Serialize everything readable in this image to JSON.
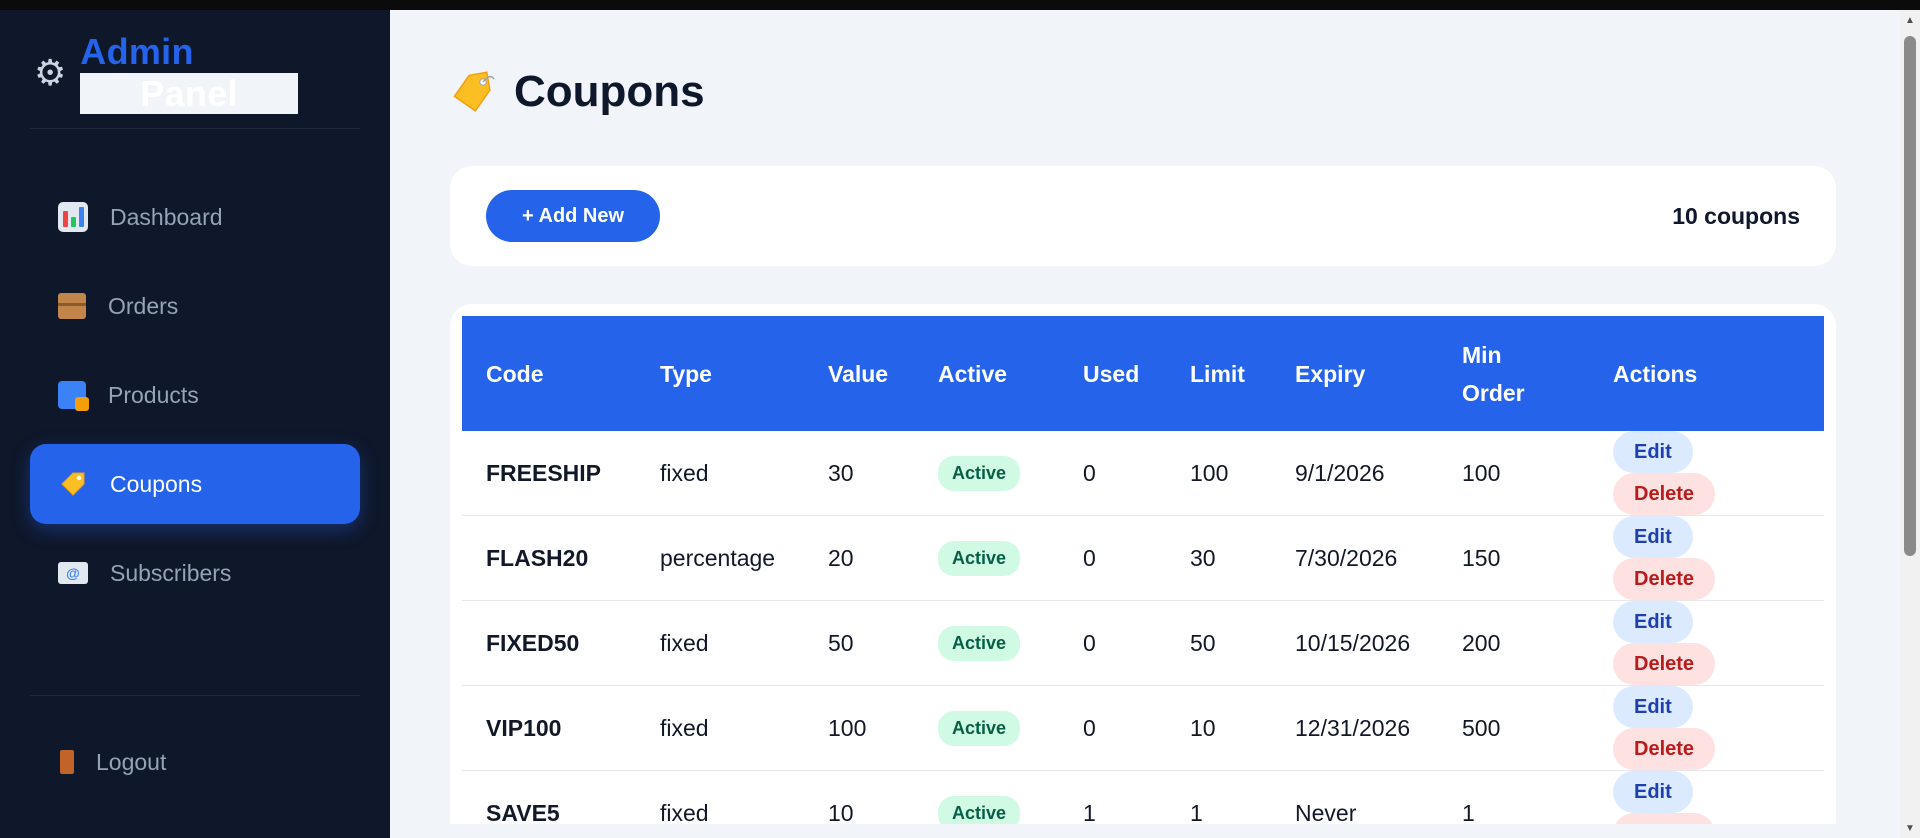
{
  "brand": {
    "accent": "Admin",
    "main": "Panel",
    "icon": "gear-icon"
  },
  "nav": {
    "items": [
      {
        "label": "Dashboard",
        "icon": "bar-chart-icon",
        "active": false
      },
      {
        "label": "Orders",
        "icon": "package-icon",
        "active": false
      },
      {
        "label": "Products",
        "icon": "shopping-bags-icon",
        "active": false
      },
      {
        "label": "Coupons",
        "icon": "tag-icon",
        "active": true
      },
      {
        "label": "Subscribers",
        "icon": "envelope-icon",
        "active": false
      }
    ],
    "logout": "Logout"
  },
  "page": {
    "title": "Coupons",
    "icon": "tag-icon"
  },
  "toolbar": {
    "add_label": "+ Add New",
    "count": "10 coupons"
  },
  "table": {
    "headers": [
      "Code",
      "Type",
      "Value",
      "Active",
      "Used",
      "Limit",
      "Expiry",
      "Min Order",
      "Actions"
    ],
    "header_min": "Min",
    "header_order": "Order",
    "edit_label": "Edit",
    "delete_label": "Delete",
    "rows": [
      {
        "code": "FREESHIP",
        "type": "fixed",
        "value": "30",
        "active": "Active",
        "used": "0",
        "limit": "100",
        "expiry": "9/1/2026",
        "min_order": "100"
      },
      {
        "code": "FLASH20",
        "type": "percentage",
        "value": "20",
        "active": "Active",
        "used": "0",
        "limit": "30",
        "expiry": "7/30/2026",
        "min_order": "150"
      },
      {
        "code": "FIXED50",
        "type": "fixed",
        "value": "50",
        "active": "Active",
        "used": "0",
        "limit": "50",
        "expiry": "10/15/2026",
        "min_order": "200"
      },
      {
        "code": "VIP100",
        "type": "fixed",
        "value": "100",
        "active": "Active",
        "used": "0",
        "limit": "10",
        "expiry": "12/31/2026",
        "min_order": "500"
      },
      {
        "code": "SAVE5",
        "type": "fixed",
        "value": "10",
        "active": "Active",
        "used": "1",
        "limit": "1",
        "expiry": "Never",
        "min_order": "1"
      }
    ]
  },
  "colors": {
    "sidebar_bg": "#0f172a",
    "accent": "#2563eb",
    "main_bg": "#f1f5f9",
    "badge_bg": "#d1fae5",
    "badge_text": "#065f46",
    "edit_bg": "#dbeafe",
    "delete_bg": "#fee2e2",
    "delete_text": "#b91c1c"
  }
}
